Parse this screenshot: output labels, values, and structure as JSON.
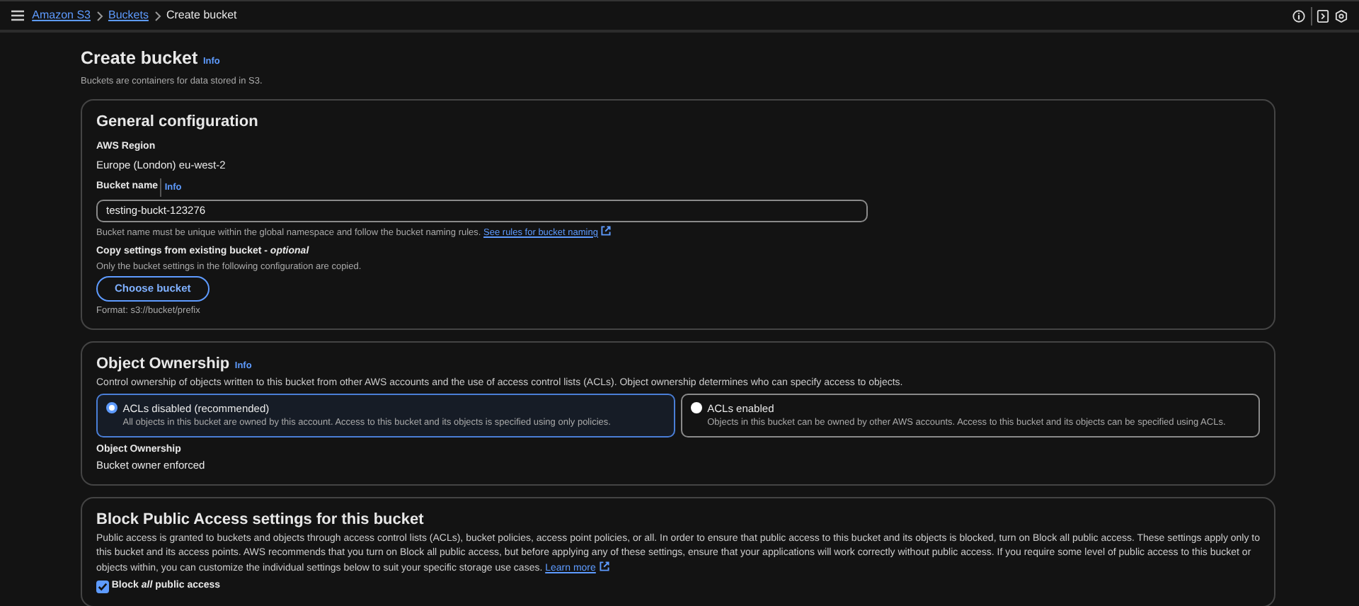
{
  "breadcrumbs": [
    {
      "label": "Amazon S3",
      "kind": "link"
    },
    {
      "label": "Buckets",
      "kind": "link"
    },
    {
      "label": "Create bucket",
      "kind": "current"
    }
  ],
  "page": {
    "title": "Create bucket",
    "info": "Info",
    "description": "Buckets are containers for data stored in S3."
  },
  "general_configuration": {
    "title": "General configuration",
    "region_label": "AWS Region",
    "region_value": "Europe (London) eu-west-2",
    "bucket_name_label": "Bucket name",
    "bucket_name_info": "Info",
    "bucket_name_value": "testing-buckt-123276",
    "bucket_name_hint": "Bucket name must be unique within the global namespace and follow the bucket naming rules.",
    "rules_link": "See rules for bucket naming",
    "copy_label": "Copy settings from existing bucket - *optional*",
    "copy_hint": "Only the bucket settings in the following configuration are copied.",
    "choose_button": "Choose bucket",
    "format_hint": "Format: s3://bucket/prefix"
  },
  "object_ownership": {
    "title": "Object Ownership",
    "info": "Info",
    "description": "Control ownership of objects written to this bucket from other AWS accounts and the use of access control lists (ACLs). Object ownership determines who can specify access to objects.",
    "options": [
      {
        "label": "ACLs disabled (recommended)",
        "description": "All objects in this bucket are owned by this account. Access to this bucket and its objects is specified using only policies.",
        "selected": true
      },
      {
        "label": "ACLs enabled",
        "description": "Objects in this bucket can be owned by other AWS accounts. Access to this bucket and its objects can be specified using ACLs.",
        "selected": false
      }
    ],
    "ownership_label": "Object Ownership",
    "ownership_value": "Bucket owner enforced"
  },
  "block_public_access": {
    "title": "Block Public Access settings for this bucket",
    "description": "Public access is granted to buckets and objects through access control lists (ACLs), bucket policies, access point policies, or all. In order to ensure that public access to this bucket and its objects is blocked, turn on Block all public access. These settings apply only to this bucket and its access points. AWS recommends that you turn on Block all public access, but before applying any of these settings, ensure that your applications will work correctly without public access. If you require some level of public access to this bucket or objects within, you can customize the individual settings below to suit your specific storage use cases.",
    "learn_more": "Learn more",
    "block_all": {
      "label": "Block *all* public access",
      "checked": true
    }
  }
}
